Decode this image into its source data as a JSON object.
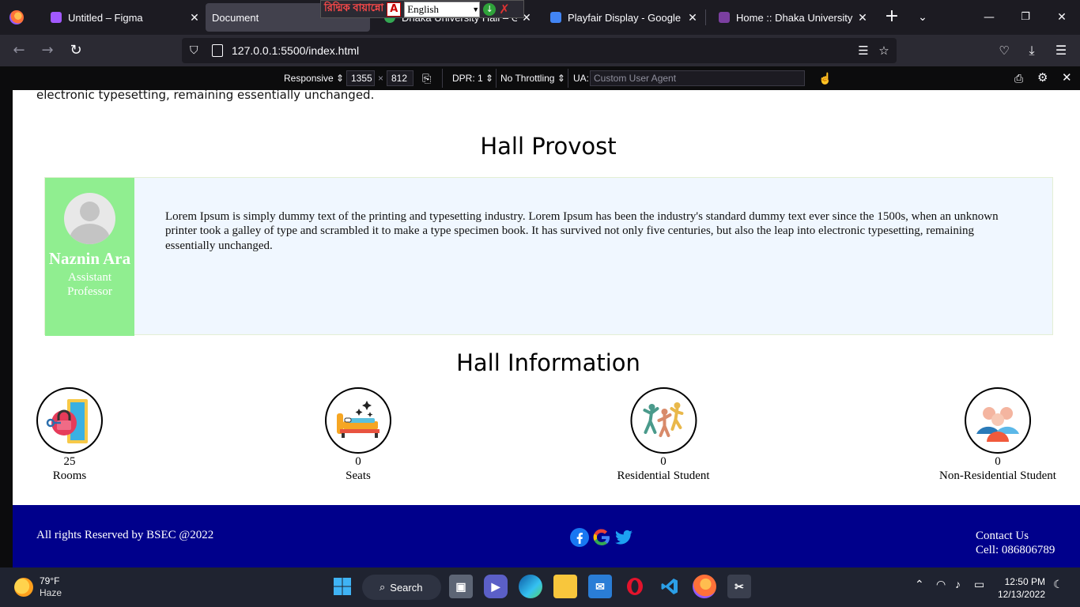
{
  "tabs": [
    {
      "title": "Untitled – Figma",
      "favicon_color": "#a259ff"
    },
    {
      "title": "Document",
      "favicon_color": "#42414d"
    },
    {
      "title": "Dhaka University Hall – Google",
      "favicon_color": "#34a853"
    },
    {
      "title": "Playfair Display - Google Fonts",
      "favicon_color": "#4285f4"
    },
    {
      "title": "Home :: Dhaka University Hall",
      "favicon_color": "#7b3fa0"
    }
  ],
  "lang_widget": {
    "title": "রিদ্মিক বায়ান্নো",
    "selected": "English"
  },
  "window_controls": {
    "minimize": "—",
    "restore": "❐",
    "close": "✕"
  },
  "navbar": {
    "url": "127.0.0.1:5500/index.html"
  },
  "rdm": {
    "device": "Responsive",
    "width": "1355",
    "times": "×",
    "height": "812",
    "dpr": "DPR: 1",
    "throttling": "No Throttling",
    "ua_label": "UA:",
    "ua_placeholder": "Custom User Agent"
  },
  "page": {
    "top_text": "electronic typesetting, remaining essentially unchanged.",
    "provost_heading": "Hall Provost",
    "provost": {
      "name": "Naznin Ara",
      "role": "Assistant Professor",
      "bio": "Lorem Ipsum is simply dummy text of the printing and typesetting industry. Lorem Ipsum has been the industry's standard dummy text ever since the 1500s, when an unknown printer took a galley of type and scrambled it to make a type specimen book. It has survived not only five centuries, but also the leap into electronic typesetting, remaining essentially unchanged."
    },
    "info_heading": "Hall Information",
    "stats": [
      {
        "value": "25",
        "label": "Rooms",
        "icon": "door-lock-icon"
      },
      {
        "value": "0",
        "label": "Seats",
        "icon": "bed-icon"
      },
      {
        "value": "0",
        "label": "Residential Student",
        "icon": "dancing-people-icon"
      },
      {
        "value": "0",
        "label": "Non-Residential Student",
        "icon": "group-icon"
      }
    ],
    "footer": {
      "copyright": "All rights Reserved by BSEC @2022",
      "social": [
        "facebook-icon",
        "google-icon",
        "twitter-icon"
      ],
      "contact_title": "Contact Us",
      "contact_cell": "Cell: 086806789"
    }
  },
  "taskbar": {
    "weather_temp": "79°F",
    "weather_desc": "Haze",
    "search_label": "Search",
    "time": "12:50 PM",
    "date": "12/13/2022"
  }
}
